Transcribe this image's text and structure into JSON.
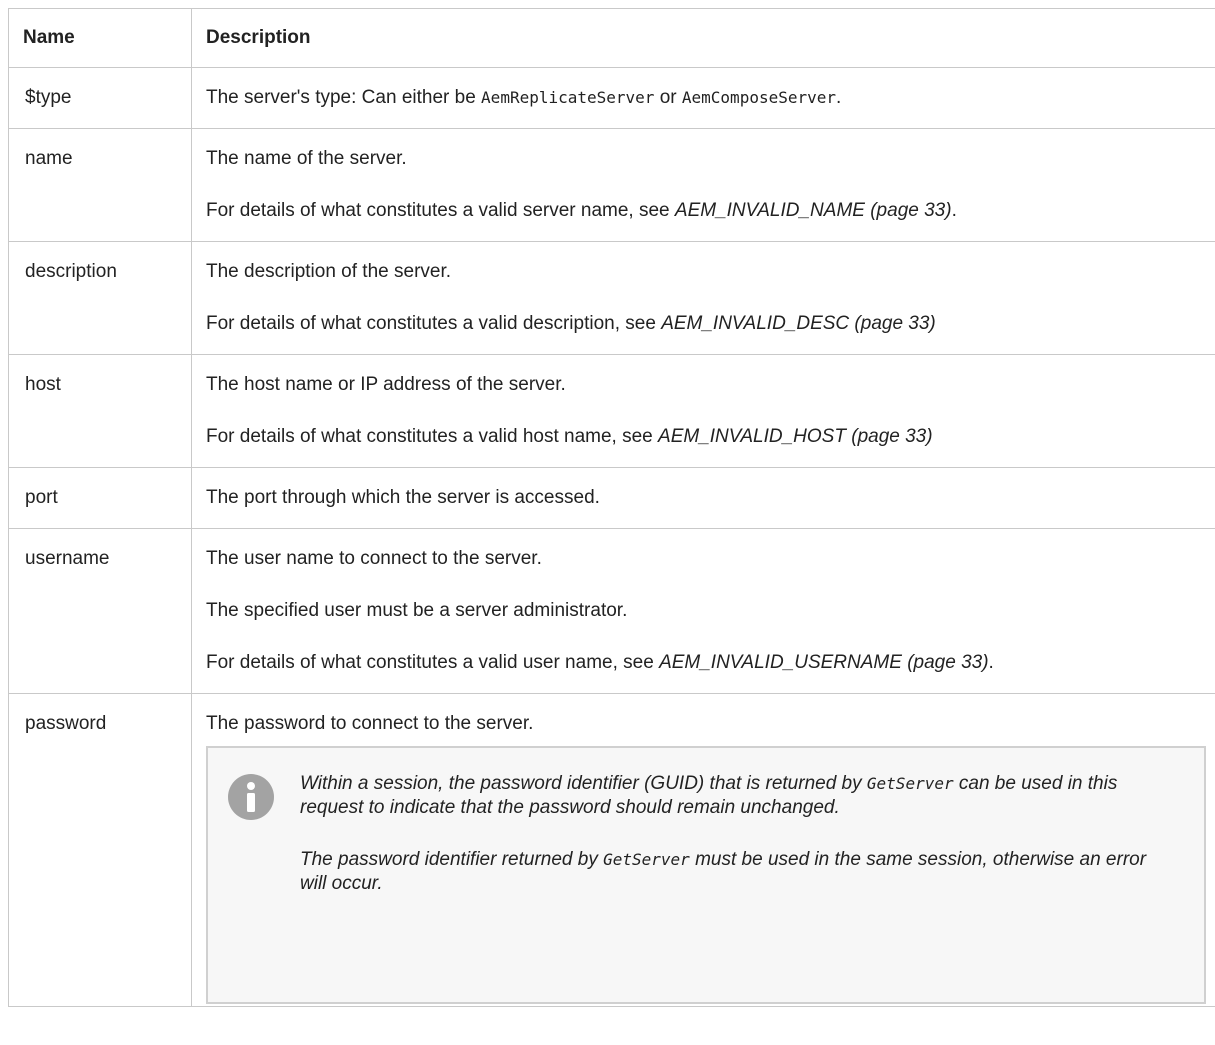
{
  "table": {
    "headers": {
      "name": "Name",
      "description": "Description"
    },
    "rows": {
      "type": {
        "name": "$type",
        "text_before": "The server's type: Can either be ",
        "code1": "AemReplicateServer",
        "text_middle": " or ",
        "code2": "AemComposeServer",
        "text_after": "."
      },
      "name": {
        "name": "name",
        "line1": "The name of the server.",
        "line2_prefix": "For details of what constitutes a valid server name, see ",
        "line2_ref": "AEM_INVALID_NAME (page 33)",
        "line2_suffix": "."
      },
      "description": {
        "name": "description",
        "line1": "The description of the server.",
        "line2_prefix": "For details of what constitutes a valid description, see ",
        "line2_ref": "AEM_INVALID_DESC (page 33)"
      },
      "host": {
        "name": "host",
        "line1": "The host name or IP address of the server.",
        "line2_prefix": "For details of what constitutes a valid host name, see ",
        "line2_ref": "AEM_INVALID_HOST (page 33)"
      },
      "port": {
        "name": "port",
        "line1": "The port through which the server is accessed."
      },
      "username": {
        "name": "username",
        "line1": "The user name to connect to the server.",
        "line2": "The specified user must be a server administrator.",
        "line3_prefix": "For details of what constitutes a valid user name, see ",
        "line3_ref": "AEM_INVALID_USERNAME (page 33)",
        "line3_suffix": "."
      },
      "password": {
        "name": "password",
        "line1": "The password to connect to the server.",
        "note": {
          "icon": "info-icon",
          "p1_before": "Within a session, the password identifier (GUID) that is returned by ",
          "p1_code": "GetServer",
          "p1_after": " can be used in this request to indicate that the password should remain unchanged.",
          "p2_before": "The password identifier returned by ",
          "p2_code": "GetServer",
          "p2_after": " must be used in the same session, otherwise an error will occur."
        }
      }
    }
  },
  "colors": {
    "border": "#c9c9c9",
    "note_background": "#f7f7f7",
    "icon": "#a3a3a3"
  }
}
